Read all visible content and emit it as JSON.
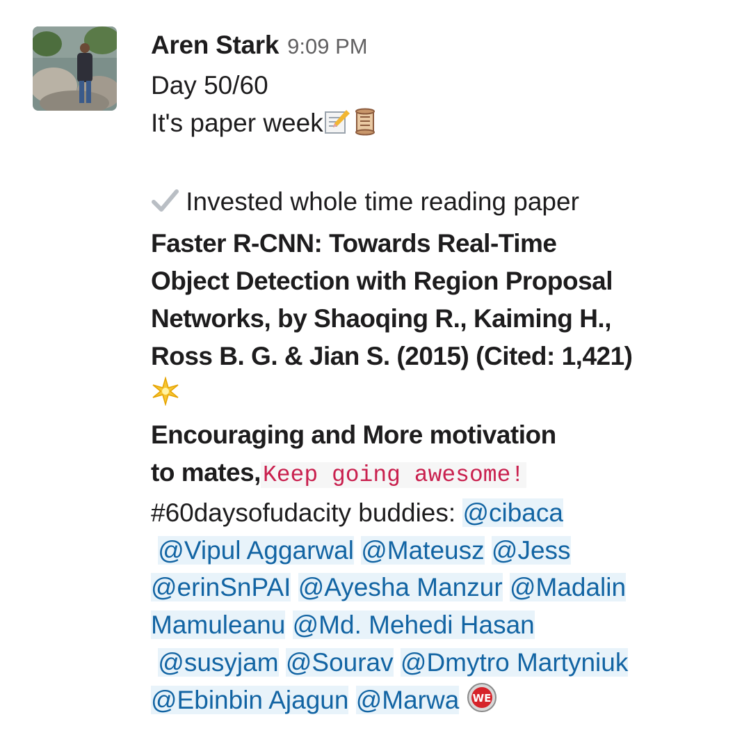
{
  "message": {
    "author": "Aren Stark",
    "time": "9:09 PM",
    "lines": {
      "day": "Day 50/60",
      "paper_week": "It's paper week",
      "invested": " Invested whole time reading paper",
      "paper_title_1": "Faster R-CNN: Towards Real-Time",
      "paper_title_2": "Object Detection with Region Proposal",
      "paper_title_3": "Networks, by Shaoqing R., Kaiming H.,",
      "paper_title_4": "Ross B. G. & Jian S. (2015) (Cited: 1,421)",
      "encouraging": "Encouraging and More motivation",
      "to_mates": "to mates,",
      "keep_going": "Keep going awesome!",
      "hashtag": "#60daysofudacity buddies: "
    },
    "mentions": [
      "@cibaca",
      "@Vipul Aggarwal",
      "@Mateusz",
      "@Jess",
      "@erinSnPAI",
      "@Ayesha Manzur",
      "@Madalin",
      "Mamuleanu",
      "@Md. Mehedi Hasan",
      "@susyjam",
      "@Sourav",
      "@Dmytro Martyniuk",
      "@Ebinbin Ajagun",
      "@Marwa"
    ],
    "badge_text": "WE"
  }
}
